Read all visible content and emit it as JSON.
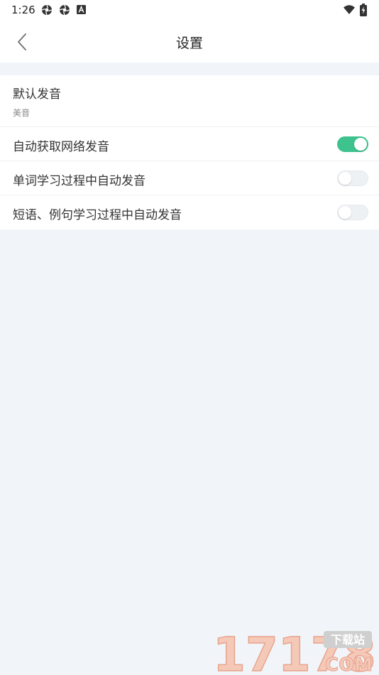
{
  "status_bar": {
    "time": "1:26",
    "left_icons": [
      "aperture-icon",
      "aperture-icon",
      "accessibility-a-icon"
    ],
    "right_icons": [
      "wifi-icon",
      "battery-charging-icon"
    ]
  },
  "header": {
    "title": "设置",
    "back_icon": "chevron-left-icon"
  },
  "settings": {
    "default_pronunciation": {
      "title": "默认发音",
      "value": "美音"
    },
    "toggles": [
      {
        "label": "自动获取网络发音",
        "on": true
      },
      {
        "label": "单词学习过程中自动发音",
        "on": false
      },
      {
        "label": "短语、例句学习过程中自动发音",
        "on": false
      }
    ]
  },
  "colors": {
    "accent": "#3ec28e",
    "page_bg": "#f1f5f9",
    "card_bg": "#ffffff",
    "toggle_off": "#eef1f4"
  },
  "watermark": {
    "numbers": "17178",
    "badge": "下载站",
    "suffix": "COM"
  }
}
